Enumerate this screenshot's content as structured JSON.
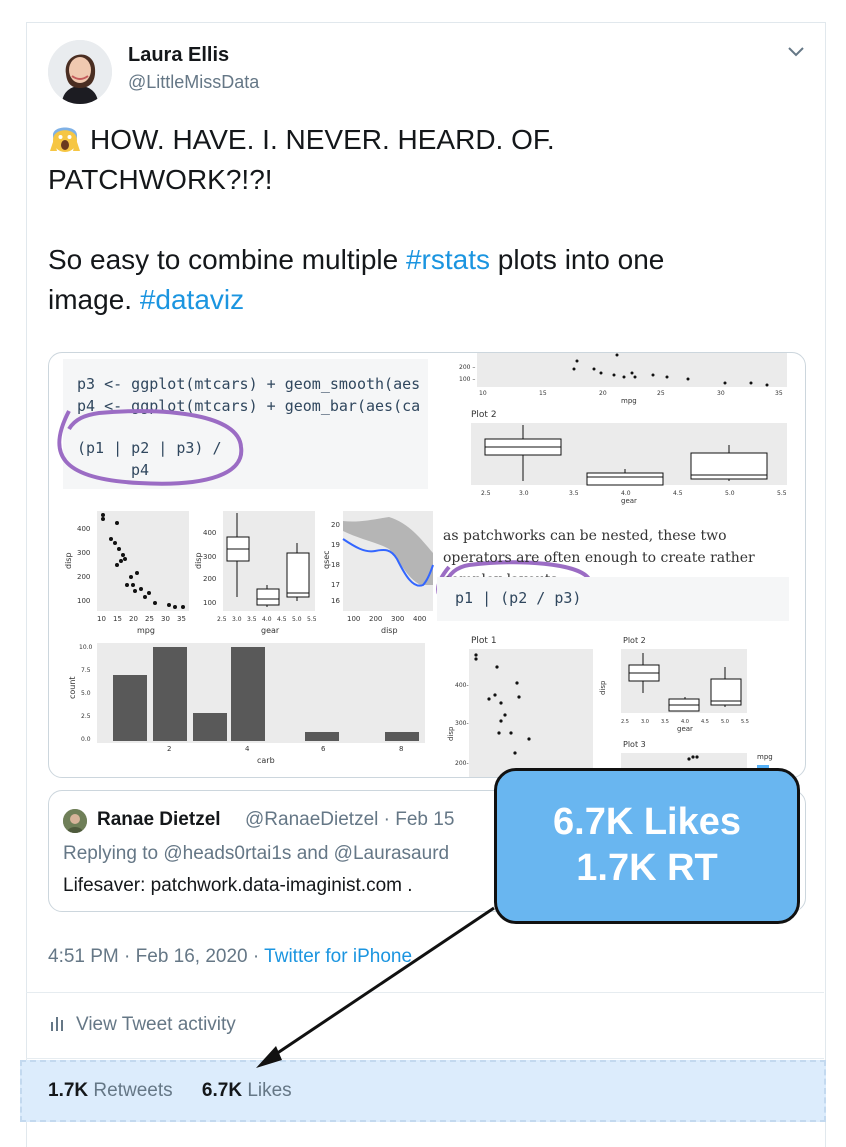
{
  "author": {
    "name": "Laura Ellis",
    "handle": "@LittleMissData",
    "avatar_icon": "avatar-photo"
  },
  "tweet": {
    "emoji_icon": "screaming-face-emoji",
    "line1_rest": "HOW. HAVE. I. NEVER. HEARD. OF.",
    "line2": "PATCHWORK?!?!",
    "line3_pre": "So easy to combine multiple ",
    "hashtag1": "#rstats",
    "line3_post": " plots into one",
    "line4_pre": "image. ",
    "hashtag2": "#dataviz",
    "hashtag_color": "#1b95e0"
  },
  "media": {
    "code_line1": "p3 <- ggplot(mtcars) + geom_smooth(aes",
    "code_line2": "p4 <- ggplot(mtcars) + geom_bar(aes(ca",
    "code_line3": "(p1 | p2 | p3) /",
    "code_line4": "p4",
    "code_nested": "p1 | (p2 / p3)",
    "prose": "as patchworks can be nested, these two operators are often enough to create rather complex layouts:",
    "plot2_label": "Plot 2",
    "plot1_label": "Plot 1",
    "plot2b_label": "Plot 2",
    "plot3_label": "Plot 3",
    "legend_label": "mpg",
    "axis_mpg": "mpg",
    "axis_gear": "gear",
    "axis_disp": "disp",
    "axis_qsec": "qsec",
    "axis_count": "count",
    "axis_carb": "carb",
    "ticks_mpg_top": [
      "10",
      "15",
      "20",
      "25",
      "30",
      "35"
    ],
    "ticks_gear": [
      "2.5",
      "3.0",
      "3.5",
      "4.0",
      "4.5",
      "5.0",
      "5.5"
    ],
    "ticks_count": [
      "10.0",
      "7.5",
      "5.0",
      "2.5",
      "0.0"
    ],
    "ticks_carb": [
      "2",
      "4",
      "6",
      "8"
    ],
    "ticks_disp_left": [
      "400",
      "300",
      "200",
      "100"
    ],
    "ticks_mpg_left": [
      "10",
      "15",
      "20",
      "25",
      "30",
      "35"
    ],
    "ticks_qsec": [
      "20",
      "19",
      "18",
      "17",
      "16"
    ],
    "ticks_disp_bottom": [
      "100",
      "200",
      "300",
      "400"
    ]
  },
  "quote": {
    "name": "Ranae Dietzel",
    "handle": "@RanaeDietzel",
    "date": "Feb 15",
    "reply_prefix": "Replying to @heads0rtai1s and @Laurasaurd",
    "text": "Lifesaver: patchwork.data-imaginist.com ."
  },
  "meta": {
    "time": "4:51 PM · Feb 16, 2020 · ",
    "source": "Twitter for iPhone"
  },
  "activity": {
    "icon": "bar-chart-icon",
    "label": "View Tweet activity"
  },
  "stats": {
    "retweets_count": "1.7K",
    "retweets_label": "Retweets",
    "likes_count": "6.7K",
    "likes_label": "Likes"
  },
  "callout": {
    "line1": "6.7K Likes",
    "line2": "1.7K RT",
    "color": "#69b6f0"
  }
}
